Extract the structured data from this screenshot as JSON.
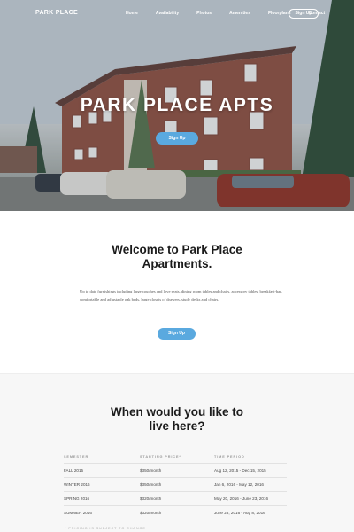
{
  "nav": {
    "brand": "PARK PLACE",
    "links": [
      "Home",
      "Availability",
      "Photos",
      "Amenities",
      "Floorplans",
      "Contact"
    ],
    "signup": "Sign Up"
  },
  "hero": {
    "title": "PARK PLACE APTS",
    "button": "Sign Up"
  },
  "welcome": {
    "title_line1": "Welcome to Park Place",
    "title_line2": "Apartments.",
    "text": "Up to date furnishings including large couches and love seats, dining room tables and chairs, accessory tables, breakfast-bar, comfortable and adjustable oak beds, large closets of drawers, study desks and chairs.",
    "button": "Sign Up"
  },
  "pricing": {
    "title_line1": "When would you like to",
    "title_line2": "live here?",
    "headers": [
      "SEMESTER",
      "STARTING PRICE*",
      "TIME PERIOD"
    ],
    "rows": [
      [
        "FALL 2015",
        "$350/month",
        "Aug 12, 2015 - Dec 15, 2015"
      ],
      [
        "WINTER 2016",
        "$350/month",
        "Jan 6, 2016 - May 12, 2016"
      ],
      [
        "SPRING 2016",
        "$320/month",
        "May 20, 2016 - June 23, 2016"
      ],
      [
        "SUMMER 2016",
        "$320/month",
        "June 28, 2016 - Aug 8, 2016"
      ]
    ],
    "footnote": "* PRICING IS SUBJECT TO CHANGE"
  },
  "colors": {
    "accent": "#5aa9df",
    "pricing_bg": "#f7f7f7"
  }
}
